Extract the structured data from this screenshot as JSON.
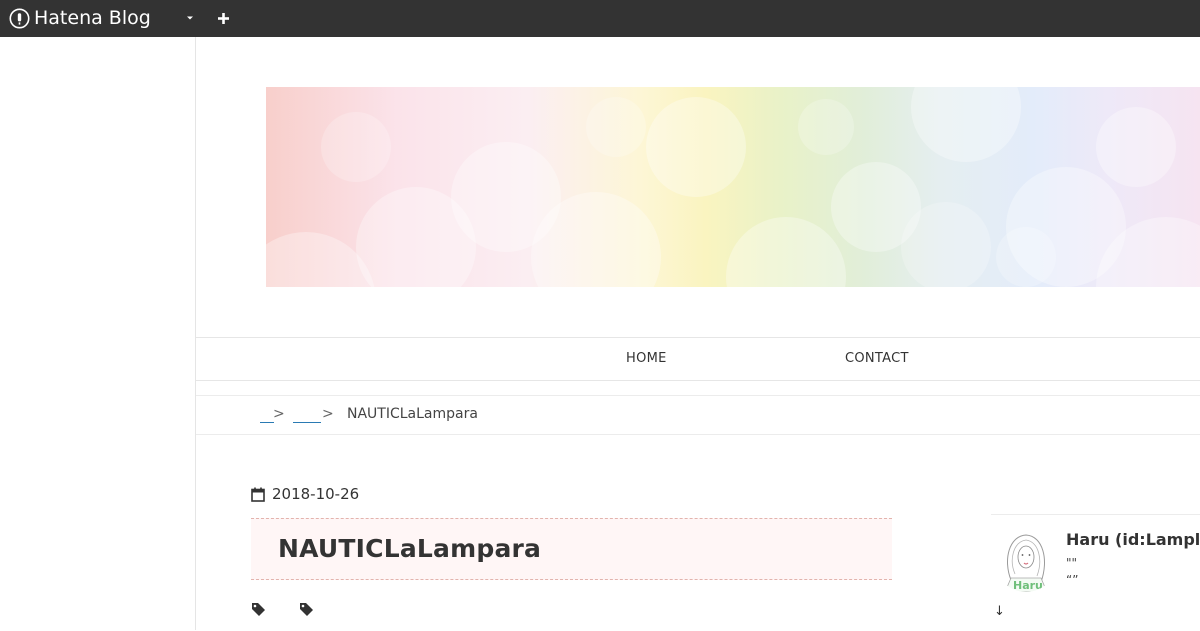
{
  "topbar": {
    "brand_text": "Hatena Blog",
    "brand_icon": "hatena-logo-icon",
    "menu_icon": "caret-down-icon",
    "add_icon": "plus-icon"
  },
  "nav": {
    "home": "HOME",
    "contact": "CONTACT"
  },
  "breadcrumb": {
    "home": "　",
    "sep": ">",
    "category": "　　",
    "current": "NAUTICLaLampara"
  },
  "entry": {
    "date": "2018-10-26",
    "title": "NAUTICLaLampara",
    "tags": [
      "",
      ""
    ]
  },
  "profile": {
    "name": "Haru (id:Lamplit",
    "line1": "\"\"",
    "line2": "“”",
    "more": "↓"
  },
  "colors": {
    "topbar": "#333333",
    "link": "#2a7ab3",
    "title_bg": "#fff6f6",
    "title_border": "#e3b3ad"
  }
}
